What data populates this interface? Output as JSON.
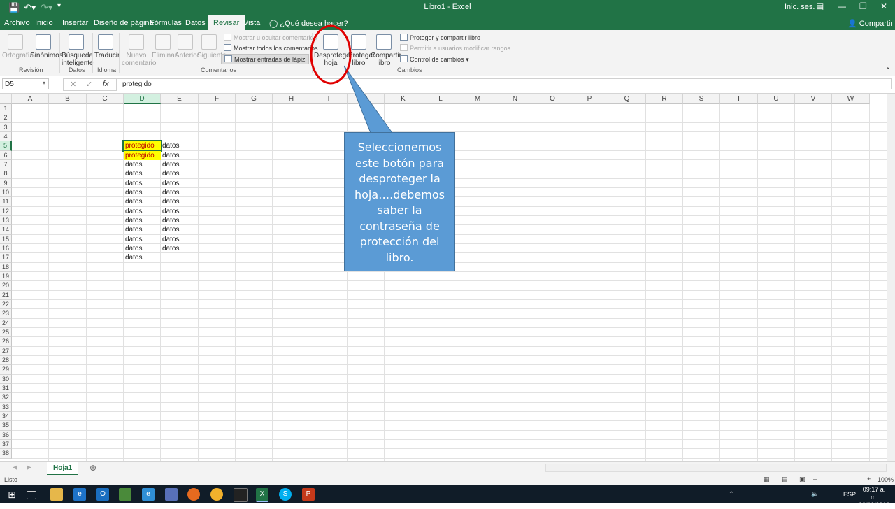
{
  "window": {
    "title": "Libro1 - Excel",
    "sign_in": "Inic. ses."
  },
  "tabs": [
    "Archivo",
    "Inicio",
    "Insertar",
    "Diseño de página",
    "Fórmulas",
    "Datos",
    "Revisar",
    "Vista"
  ],
  "active_tab": "Revisar",
  "tell_me": "¿Qué desea hacer?",
  "share_label": "Compartir",
  "ribbon": {
    "revision": {
      "group_label": "Revisión",
      "spelling": "Ortografía",
      "thesaurus": "Sinónimos"
    },
    "datos": {
      "group_label": "Datos",
      "smart_lookup_1": "Búsqueda",
      "smart_lookup_2": "inteligente"
    },
    "idioma": {
      "group_label": "Idioma",
      "translate": "Traducir"
    },
    "comentarios": {
      "group_label": "Comentarios",
      "new_1": "Nuevo",
      "new_2": "comentario",
      "delete": "Eliminar",
      "previous": "Anterior",
      "next": "Siguiente",
      "show_hide": "Mostrar u ocultar comentarios",
      "show_all": "Mostrar todos los comentarios",
      "show_ink": "Mostrar entradas de lápiz"
    },
    "cambios": {
      "group_label": "Cambios",
      "unprotect_sheet_1": "Desproteger",
      "unprotect_sheet_2": "hoja",
      "protect_book_1": "Proteger",
      "protect_book_2": "libro",
      "share_book_1": "Compartir",
      "share_book_2": "libro",
      "protect_share": "Proteger y compartir libro",
      "allow_ranges": "Permitir a usuarios modificar rangos",
      "track_changes": "Control de cambios"
    }
  },
  "formula_bar": {
    "name_box": "D5",
    "fx": "fx",
    "content": "protegido"
  },
  "columns": [
    "A",
    "B",
    "C",
    "D",
    "E",
    "F",
    "G",
    "H",
    "I",
    "J",
    "K",
    "L",
    "M",
    "N",
    "O",
    "P",
    "Q",
    "R",
    "S",
    "T",
    "U",
    "V",
    "W"
  ],
  "rows": [
    "1",
    "2",
    "3",
    "4",
    "5",
    "6",
    "7",
    "8",
    "9",
    "10",
    "11",
    "12",
    "13",
    "14",
    "15",
    "16",
    "17",
    "18",
    "19",
    "20",
    "21",
    "22",
    "23",
    "24",
    "25",
    "26",
    "27",
    "28",
    "29",
    "30",
    "31",
    "32",
    "33",
    "34",
    "35",
    "36",
    "37",
    "38"
  ],
  "cells": {
    "D": [
      "protegido",
      "protegido",
      "datos",
      "datos",
      "datos",
      "datos",
      "datos",
      "datos",
      "datos",
      "datos",
      "datos",
      "datos",
      "datos"
    ],
    "E": [
      "datos",
      "datos",
      "datos",
      "datos",
      "datos",
      "datos",
      "datos",
      "datos",
      "datos",
      "datos",
      "datos",
      "datos"
    ]
  },
  "colors": {
    "excel_green": "#217346",
    "highlight_fill": "#ffff00",
    "highlight_text": "#c00000",
    "callout_fill": "#5b9bd5",
    "circle": "#e00000"
  },
  "callout_text": "Seleccionemos este botón para desproteger la hoja….debemos saber la contraseña de protección del libro.",
  "sheet_tab": "Hoja1",
  "status": {
    "ready": "Listo",
    "zoom": "100%"
  },
  "taskbar": {
    "time": "09:17 a. m.",
    "date": "23/11/2016",
    "lang": "ESP"
  }
}
